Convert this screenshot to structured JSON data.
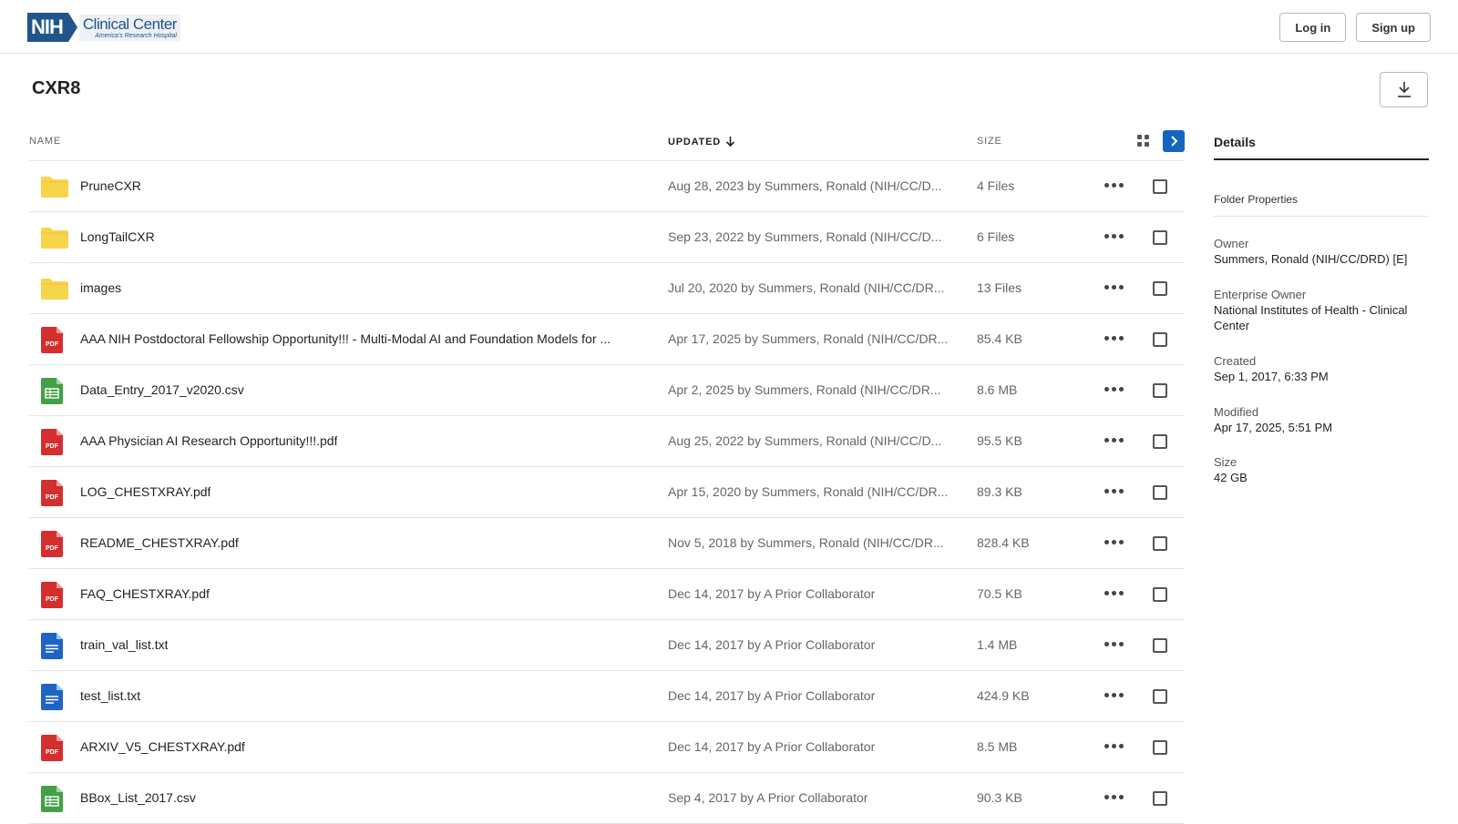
{
  "header": {
    "logo_badge": "NIH",
    "logo_main": "Clinical Center",
    "logo_sub": "America's Research Hospital",
    "login_label": "Log in",
    "signup_label": "Sign up"
  },
  "page": {
    "title": "CXR8"
  },
  "table": {
    "col_name": "NAME",
    "col_updated": "UPDATED",
    "col_size": "SIZE",
    "rows": [
      {
        "type": "folder",
        "name": "PruneCXR",
        "updated": "Aug 28, 2023 by Summers, Ronald (NIH/CC/D...",
        "size": "4 Files"
      },
      {
        "type": "folder",
        "name": "LongTailCXR",
        "updated": "Sep 23, 2022 by Summers, Ronald (NIH/CC/D...",
        "size": "6 Files"
      },
      {
        "type": "folder",
        "name": "images",
        "updated": "Jul 20, 2020 by Summers, Ronald (NIH/CC/DR...",
        "size": "13 Files"
      },
      {
        "type": "pdf",
        "name": "AAA NIH Postdoctoral Fellowship Opportunity!!! - Multi-Modal AI and Foundation Models for ...",
        "updated": "Apr 17, 2025 by Summers, Ronald (NIH/CC/DR...",
        "size": "85.4 KB"
      },
      {
        "type": "csv",
        "name": "Data_Entry_2017_v2020.csv",
        "updated": "Apr 2, 2025 by Summers, Ronald (NIH/CC/DR...",
        "size": "8.6 MB"
      },
      {
        "type": "pdf",
        "name": "AAA Physician AI Research Opportunity!!!.pdf",
        "updated": "Aug 25, 2022 by Summers, Ronald (NIH/CC/D...",
        "size": "95.5 KB"
      },
      {
        "type": "pdf",
        "name": "LOG_CHESTXRAY.pdf",
        "updated": "Apr 15, 2020 by Summers, Ronald (NIH/CC/DR...",
        "size": "89.3 KB"
      },
      {
        "type": "pdf",
        "name": "README_CHESTXRAY.pdf",
        "updated": "Nov 5, 2018 by Summers, Ronald (NIH/CC/DR...",
        "size": "828.4 KB"
      },
      {
        "type": "pdf",
        "name": "FAQ_CHESTXRAY.pdf",
        "updated": "Dec 14, 2017 by A Prior Collaborator",
        "size": "70.5 KB"
      },
      {
        "type": "txt",
        "name": "train_val_list.txt",
        "updated": "Dec 14, 2017 by A Prior Collaborator",
        "size": "1.4 MB"
      },
      {
        "type": "txt",
        "name": "test_list.txt",
        "updated": "Dec 14, 2017 by A Prior Collaborator",
        "size": "424.9 KB"
      },
      {
        "type": "pdf",
        "name": "ARXIV_V5_CHESTXRAY.pdf",
        "updated": "Dec 14, 2017 by A Prior Collaborator",
        "size": "8.5 MB"
      },
      {
        "type": "csv",
        "name": "BBox_List_2017.csv",
        "updated": "Sep 4, 2017 by A Prior Collaborator",
        "size": "90.3 KB"
      }
    ]
  },
  "details": {
    "tab_label": "Details",
    "section_label": "Folder Properties",
    "owner_label": "Owner",
    "owner_value": "Summers, Ronald (NIH/CC/DRD) [E]",
    "enterprise_label": "Enterprise Owner",
    "enterprise_value": "National Institutes of Health - Clinical Center",
    "created_label": "Created",
    "created_value": "Sep 1, 2017, 6:33 PM",
    "modified_label": "Modified",
    "modified_value": "Apr 17, 2025, 5:51 PM",
    "size_label": "Size",
    "size_value": "42 GB"
  },
  "icons": {
    "pdf_badge": "PDF",
    "folder_color": "#f7d54a",
    "pdf_color": "#d32f2f",
    "csv_color": "#43a047",
    "txt_color": "#1e63c5",
    "accent": "#1565c0"
  }
}
